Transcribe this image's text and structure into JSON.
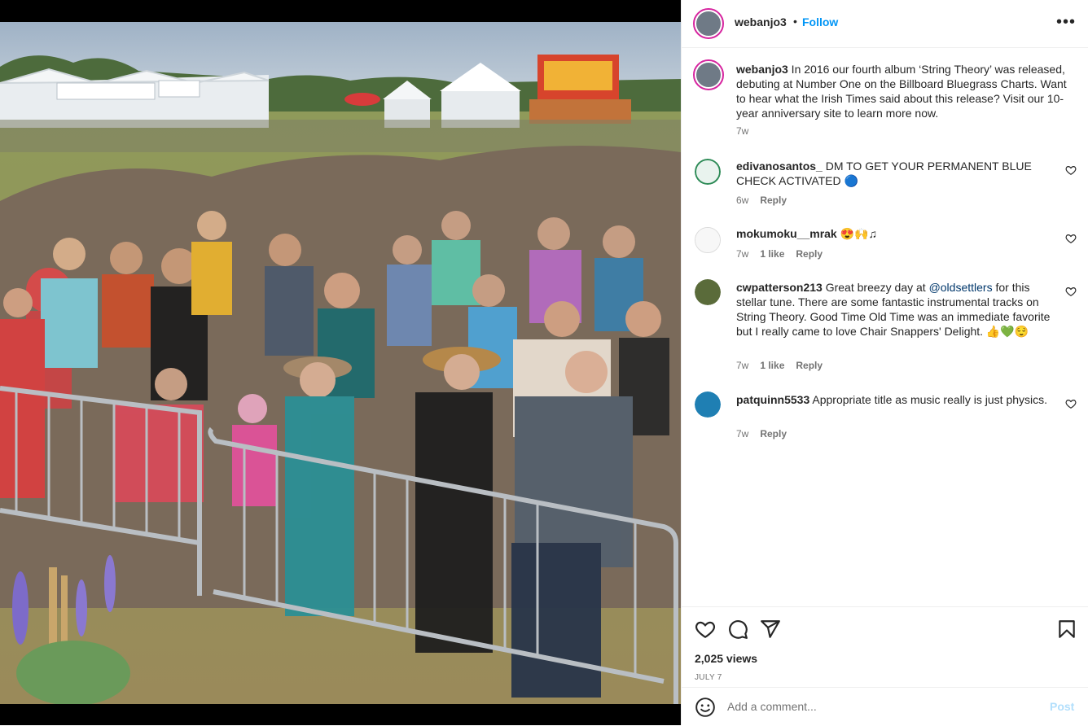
{
  "post": {
    "username": "webanjo3",
    "follow_label": "Follow",
    "separator": "•",
    "more_label": "•••",
    "caption_user": "webanjo3",
    "caption_text": " In 2016 our fourth album ‘String Theory’ was released, debuting at Number One on the Billboard Bluegrass Charts. Want to hear what the Irish Times said about this release? Visit our 10-year anniversary site to learn more now.",
    "caption_time": "7w"
  },
  "comments": [
    {
      "user": "edivanosantos_",
      "text": " DM TO GET YOUR PERMANENT BLUE CHECK ACTIVATED 🔵",
      "time": "6w",
      "likes": "",
      "reply": "Reply",
      "avatar_color": "#2e8b57"
    },
    {
      "user": "mokumoku__mrak",
      "text": " 😍🙌♫",
      "time": "7w",
      "likes": "1 like",
      "reply": "Reply",
      "avatar_color": "#eeeeee"
    },
    {
      "user": "cwpatterson213",
      "text_before": " Great breezy day at ",
      "mention": "@oldsettlers",
      "text_after": " for this stellar tune. There are some fantastic instrumental tracks on String Theory. Good Time Old Time was an immediate favorite but I really came to love Chair Snappers' Delight. 👍💚😌",
      "time": "7w",
      "likes": "1 like",
      "reply": "Reply",
      "avatar_color": "#5a6b3a"
    },
    {
      "user": "patquinn5533",
      "text": " Appropriate title as music really is just physics.",
      "time": "7w",
      "likes": "",
      "reply": "Reply",
      "avatar_color": "#1f7fb3"
    }
  ],
  "stats": {
    "views": "2,025 views",
    "date": "JULY 7"
  },
  "composer": {
    "placeholder": "Add a comment...",
    "post_label": "Post"
  },
  "colors": {
    "accent": "#0095f6",
    "post_disabled": "#b2dffc",
    "mention": "#00376b",
    "muted": "#737373"
  },
  "icons": {
    "like": "heart-icon",
    "comment": "comment-icon",
    "share": "share-icon",
    "save": "bookmark-icon",
    "emoji": "emoji-icon",
    "more": "more-icon"
  }
}
